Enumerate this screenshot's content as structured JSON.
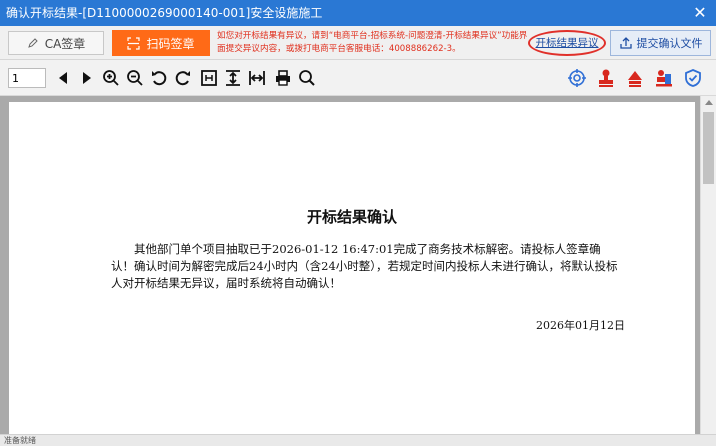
{
  "window": {
    "title": "确认开标结果-[D1100000269000140-001]安全设施施工",
    "close_glyph": "✕"
  },
  "actionbar": {
    "ca_label": "CA签章",
    "scan_label": "扫码签章",
    "notice_text": "如您对开标结果有异议，请到“电商平台-招标系统-问题澄清-开标结果异议”功能界面提交异议内容，或拨打电商平台客服电话：4008886262-3。",
    "objection_link": "开标结果异议",
    "submit_label": "提交确认文件"
  },
  "toolbar": {
    "page_value": "1",
    "icons": [
      "prev-page-icon",
      "next-page-icon",
      "zoom-in-icon",
      "zoom-out-icon",
      "rotate-left-icon",
      "rotate-right-icon",
      "fit-page-icon",
      "fit-height-icon",
      "fit-width-icon",
      "print-icon",
      "search-icon",
      "target-icon",
      "seal-red-icon",
      "seal-stamp-icon",
      "seal-person-icon",
      "shield-check-icon"
    ]
  },
  "document": {
    "title": "开标结果确认",
    "body": "其他部门单个项目抽取已于2026-01-12 16:47:01完成了商务技术标解密。请投标人签章确认！确认时间为解密完成后24小时内（含24小时整），若规定时间内投标人未进行确认，将默认投标人对开标结果无异议，届时系统将自动确认！",
    "date": "2026年01月12日"
  },
  "status": {
    "text": "准备就绪"
  },
  "colors": {
    "titlebar": "#2a78d4",
    "scan_button": "#ff6a17",
    "notice_red": "#e0301e",
    "link_blue": "#1f4ea3",
    "highlight_ellipse": "#e0302a"
  }
}
